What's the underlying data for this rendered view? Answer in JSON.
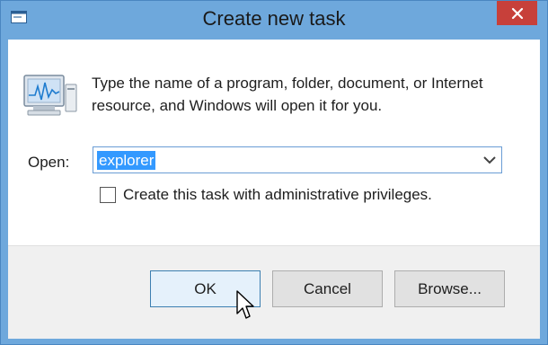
{
  "window": {
    "title": "Create new task",
    "icons": {
      "app": "run-dialog-icon",
      "close": "close-icon",
      "program": "task-manager-monitor-icon"
    }
  },
  "dialog": {
    "description": "Type the name of a program, folder, document, or Internet resource, and Windows will open it for you.",
    "open_label": "Open:",
    "open_value": "explorer",
    "admin_checkbox_label": "Create this task with administrative privileges.",
    "admin_checked": false
  },
  "buttons": {
    "ok": "OK",
    "cancel": "Cancel",
    "browse": "Browse..."
  },
  "colors": {
    "chrome": "#6ea8dc",
    "close": "#c7403a",
    "selection": "#3399ff"
  }
}
